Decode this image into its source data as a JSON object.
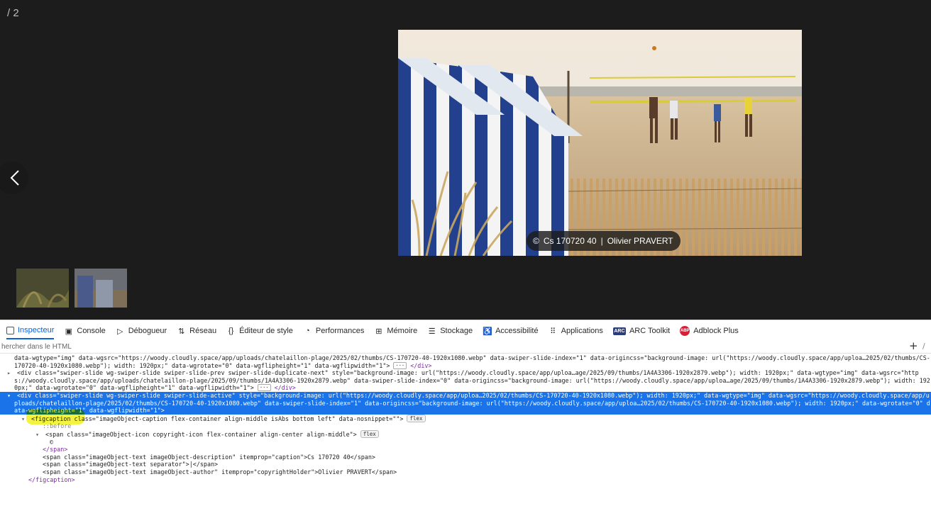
{
  "lightbox": {
    "counter": "/ 2",
    "caption": {
      "symbol": "©",
      "description": "Cs 170720 40",
      "separator": "|",
      "author": "Olivier PRAVERT"
    }
  },
  "devtools": {
    "tabs": [
      {
        "label": "Inspecteur",
        "icon": "inspector-icon",
        "active": true
      },
      {
        "label": "Console",
        "icon": "console-icon"
      },
      {
        "label": "Débogueur",
        "icon": "debugger-icon"
      },
      {
        "label": "Réseau",
        "icon": "network-icon"
      },
      {
        "label": "Éditeur de style",
        "icon": "style-editor-icon"
      },
      {
        "label": "Performances",
        "icon": "performance-icon"
      },
      {
        "label": "Mémoire",
        "icon": "memory-icon"
      },
      {
        "label": "Stockage",
        "icon": "storage-icon"
      },
      {
        "label": "Accessibilité",
        "icon": "accessibility-icon"
      },
      {
        "label": "Applications",
        "icon": "applications-icon"
      },
      {
        "label": "ARC Toolkit",
        "icon": "arc-toolkit-icon",
        "icon_text": "ARC"
      },
      {
        "label": "Adblock Plus",
        "icon": "adblock-plus-icon",
        "icon_text": "ABP"
      }
    ],
    "search_placeholder": "hercher dans le HTML",
    "add_label": "+",
    "tree": {
      "line1": {
        "text": "data-wgtype=\"img\" data-wgsrc=\"https://woody.cloudly.space/app/uploads/chatelaillon-plage/2025/02/thumbs/CS-170720-40-1920x1080.webp\" data-swiper-slide-index=\"1\" data-origincss=\"background-image: url(\"https://woody.cloudly.space/app/uploa…2025/02/thumbs/CS-170720-40-1920x1080.webp\"); width: 1920px;\" data-wgrotate=\"0\" data-wgflipheight=\"1\" data-wgflipwidth=\"1\">",
        "ellipsis": "···",
        "close": "</div>"
      },
      "line2": {
        "text": "<div class=\"swiper-slide wg-swiper-slide swiper-slide-prev swiper-slide-duplicate-next\" style=\"background-image: url(\"https://woody.cloudly.space/app/uploa…age/2025/09/thumbs/1A4A3306-1920x2879.webp\"); width: 1920px;\" data-wgtype=\"img\" data-wgsrc=\"https://woody.cloudly.space/app/uploads/chatelaillon-plage/2025/09/thumbs/1A4A3306-1920x2879.webp\" data-swiper-slide-index=\"0\" data-origincss=\"background-image: url(\"https://woody.cloudly.space/app/uploa…age/2025/09/thumbs/1A4A3306-1920x2879.webp\"); width: 1920px;\" data-wgrotate=\"0\" data-wgflipheight=\"1\" data-wgflipwidth=\"1\">",
        "ellipsis": "···",
        "close": "</div>"
      },
      "line3": {
        "text": "<div class=\"swiper-slide wg-swiper-slide swiper-slide-active\" style=\"background-image: url(\"https://woody.cloudly.space/app/uploa…2025/02/thumbs/CS-170720-40-1920x1080.webp\"); width: 1920px;\" data-wgtype=\"img\" data-wgsrc=\"https://woody.cloudly.space/app/uploads/chatelaillon-plage/2025/02/thumbs/CS-170720-40-1920x1080.webp\" data-swiper-slide-index=\"1\" data-origincss=\"background-image: url(\"https://woody.cloudly.space/app/uploa…2025/02/thumbs/CS-170720-40-1920x1080.webp\"); width: 1920px;\" data-wgrotate=\"0\" data-wgflipheight=\"1\" data-wgflipwidth=\"1\">"
      },
      "line4": {
        "text": "<figcaption class=\"imageObject-caption flex-container align-middle isAbs bottom left\" data-nosnippet=\"\">",
        "badge": "flex"
      },
      "line5": "::before",
      "line6": {
        "text": "<span class=\"imageObject-icon copyright-icon flex-container align-center align-middle\">",
        "badge": "flex"
      },
      "line7": "©",
      "line8": "</span>",
      "line9": "<span class=\"imageObject-text imageObject-description\" itemprop=\"caption\">Cs 170720 40</span>",
      "line10": "<span class=\"imageObject-text separator\">|</span>",
      "line11": "<span class=\"imageObject-text imageObject-author\" itemprop=\"copyrightHolder\">Olivier PRAVERT</span>",
      "line12": "</figcaption>"
    }
  }
}
